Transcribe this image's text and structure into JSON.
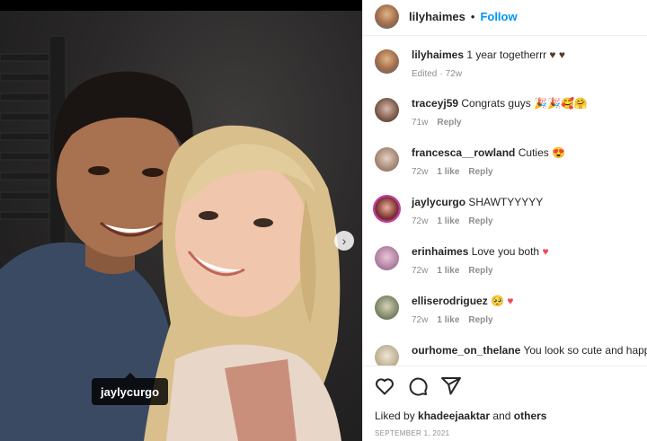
{
  "header": {
    "username": "lilyhaimes",
    "separator": "•",
    "follow_label": "Follow"
  },
  "photo": {
    "tag_username": "jaylycurgo",
    "next_arrow": "›"
  },
  "caption": {
    "username": "lilyhaimes",
    "text": " 1 year togetherrr ",
    "emoji": "♥ ♥",
    "meta_edited": "Edited",
    "meta_sep": "·",
    "meta_time": "72w"
  },
  "comments": [
    {
      "username": "traceyj59",
      "text": " Congrats guys ",
      "emoji": "🎉🎉🥰🤗",
      "time": "71w",
      "likes": "",
      "reply": "Reply",
      "avatar_color": "#6b4a3c"
    },
    {
      "username": "francesca__rowland",
      "text": " Cuties ",
      "emoji": "😍",
      "time": "72w",
      "likes": "1 like",
      "reply": "Reply",
      "avatar_color": "#9a7b68"
    },
    {
      "username": "jaylycurgo",
      "text": " SHAWTYYYYY",
      "emoji": "",
      "time": "72w",
      "likes": "1 like",
      "reply": "Reply",
      "avatar_color": "#7a2e2e"
    },
    {
      "username": "erinhaimes",
      "text": " Love you both ",
      "emoji": "♥",
      "time": "72w",
      "likes": "1 like",
      "reply": "Reply",
      "avatar_color": "#a7769a"
    },
    {
      "username": "elliserodriguez",
      "text": " ",
      "emoji": "🥺 ♥",
      "time": "72w",
      "likes": "1 like",
      "reply": "Reply",
      "avatar_color": "#6f7d5c"
    },
    {
      "username": "ourhome_on_thelane",
      "text": " You look so cute and happy",
      "emoji": "",
      "time": "",
      "likes": "",
      "reply": "",
      "avatar_color": "#b9a98e"
    }
  ],
  "actions": {
    "like_icon": "heart-icon",
    "comment_icon": "comment-icon",
    "share_icon": "share-icon"
  },
  "likes": {
    "prefix": "Liked by ",
    "user": "khadeejaaktar",
    "middle": " and ",
    "others": "others"
  },
  "date": "SEPTEMBER 1, 2021",
  "colors": {
    "follow_blue": "#0095f6",
    "meta_gray": "#8e8e8e",
    "text": "#262626",
    "heart_red": "#ed4956"
  }
}
